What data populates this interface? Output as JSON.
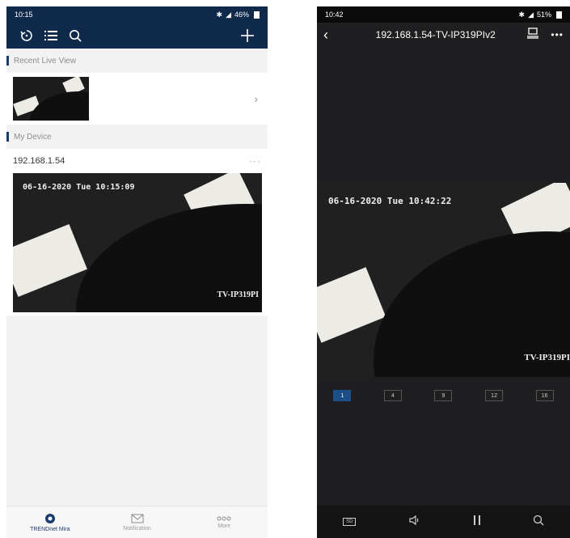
{
  "left": {
    "status_bar": {
      "time": "10:15",
      "battery": "46%"
    },
    "recent_section": {
      "title": "Recent Live View"
    },
    "device_section": {
      "title": "My Device"
    },
    "device": {
      "name": "192.168.1.54",
      "more": "···",
      "osd_time": "06-16-2020 Tue 10:15:09",
      "osd_name": "TV-IP319PI"
    },
    "bottom_nav": [
      {
        "label": "TRENDnet Mira",
        "icon": "camera-icon",
        "active": true
      },
      {
        "label": "Notification",
        "icon": "mail-icon",
        "active": false
      },
      {
        "label": "More",
        "icon": "more-icon",
        "active": false
      }
    ],
    "colors": {
      "header": "#0f2a4a",
      "accent": "#1a3c6e"
    }
  },
  "right": {
    "status_bar": {
      "time": "10:42",
      "battery": "51%"
    },
    "title": "192.168.1.54-TV-IP319PIv2",
    "osd_time": "06-16-2020 Tue 10:42:22",
    "osd_name": "TV-IP319PI",
    "split_options": [
      "1",
      "4",
      "9",
      "12",
      "16"
    ],
    "active_split": "1",
    "controls": [
      {
        "label": "SD",
        "icon": "sd-quality-icon"
      },
      {
        "icon": "speaker-icon"
      },
      {
        "icon": "pause-icon"
      },
      {
        "icon": "search-icon"
      }
    ]
  }
}
